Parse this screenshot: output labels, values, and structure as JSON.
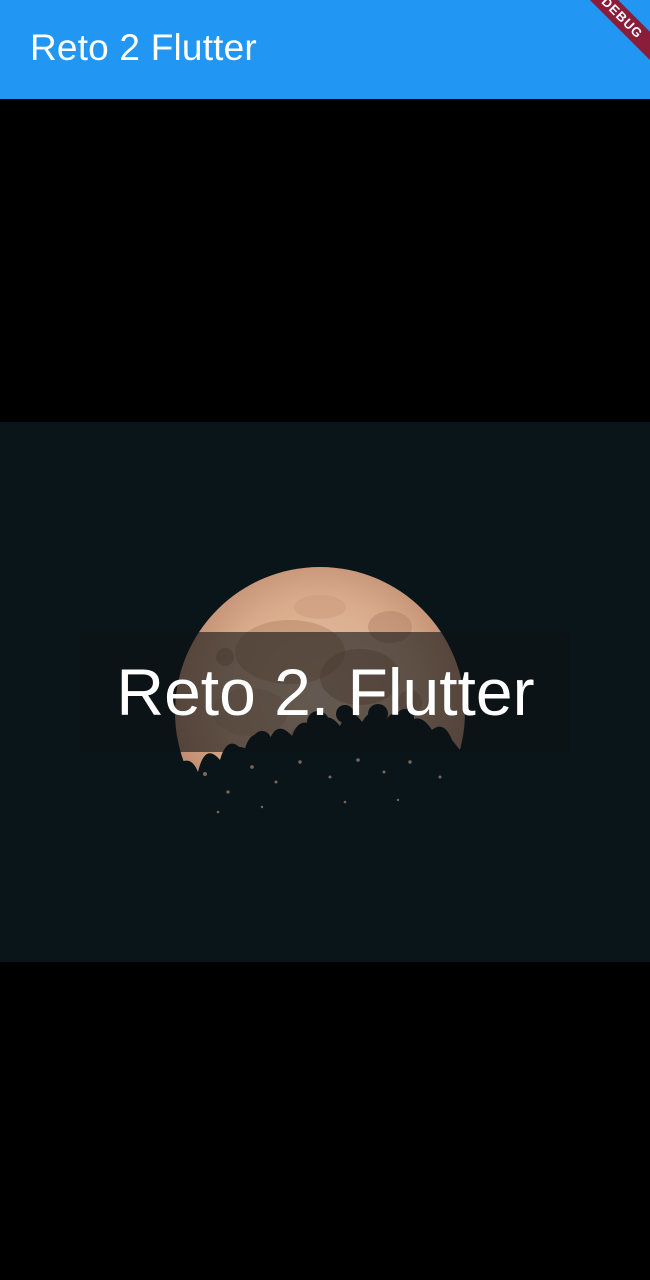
{
  "app_bar": {
    "title": "Reto 2 Flutter",
    "color": "#2196f3"
  },
  "debug_banner": {
    "label": "DEBUG",
    "color": "#8b1c3a"
  },
  "hero": {
    "image": "moon-over-trees",
    "caption": "Reto 2. Flutter"
  }
}
